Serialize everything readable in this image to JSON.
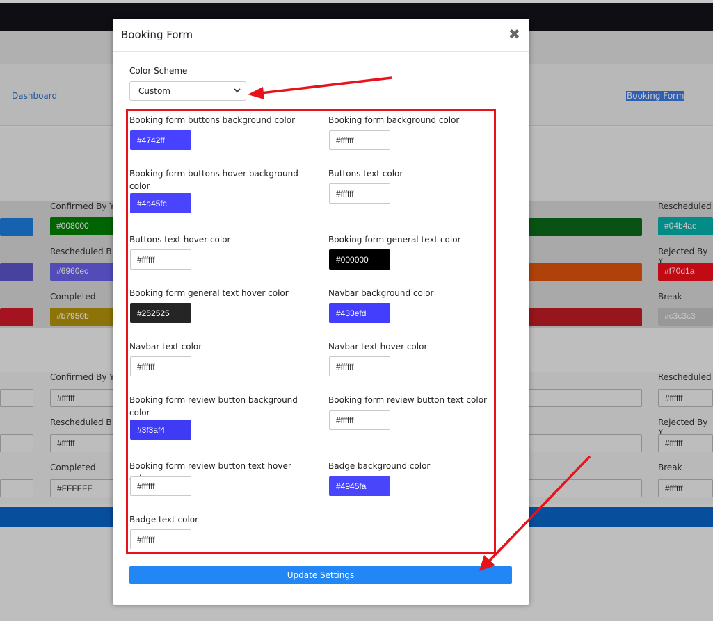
{
  "modal": {
    "title": "Booking Form",
    "color_scheme_label": "Color Scheme",
    "color_scheme_value": "Custom",
    "update_button_label": "Update Settings",
    "fields": [
      {
        "label": "Booking form buttons background color",
        "value": "#4742ff",
        "color": "#4742ff",
        "text_color": "#ffffff"
      },
      {
        "label": "Booking form background color",
        "value": "#ffffff",
        "color": "#ffffff",
        "text_color": "#222222"
      },
      {
        "label": "Booking form buttons hover background color",
        "value": "#4a45fc",
        "color": "#4a45fc",
        "text_color": "#ffffff"
      },
      {
        "label": "Buttons text color",
        "value": "#ffffff",
        "color": "#ffffff",
        "text_color": "#222222"
      },
      {
        "label": "Buttons text hover color",
        "value": "#ffffff",
        "color": "#ffffff",
        "text_color": "#222222"
      },
      {
        "label": "Booking form general text color",
        "value": "#000000",
        "color": "#000000",
        "text_color": "#ffffff"
      },
      {
        "label": "Booking form general text hover color",
        "value": "#252525",
        "color": "#252525",
        "text_color": "#ffffff"
      },
      {
        "label": "Navbar background color",
        "value": "#433efd",
        "color": "#433efd",
        "text_color": "#ffffff"
      },
      {
        "label": "Navbar text color",
        "value": "#ffffff",
        "color": "#ffffff",
        "text_color": "#222222"
      },
      {
        "label": "Navbar text hover color",
        "value": "#ffffff",
        "color": "#ffffff",
        "text_color": "#222222"
      },
      {
        "label": "Booking form review button background color",
        "value": "#3f3af4",
        "color": "#3f3af4",
        "text_color": "#ffffff"
      },
      {
        "label": "Booking form review button text color",
        "value": "#ffffff",
        "color": "#ffffff",
        "text_color": "#222222"
      },
      {
        "label": "Booking form review button text hover color",
        "value": "#ffffff",
        "color": "#ffffff",
        "text_color": "#222222"
      },
      {
        "label": "Badge background color",
        "value": "#4945fa",
        "color": "#4945fa",
        "text_color": "#ffffff"
      },
      {
        "label": "Badge text color",
        "value": "#ffffff",
        "color": "#ffffff",
        "text_color": "#222222"
      }
    ]
  },
  "background": {
    "nav_dashboard": "Dashboard",
    "nav_booking_form": "Booking Form",
    "labels": {
      "confirmed": "Confirmed By Y",
      "rescheduled_by": "Rescheduled B",
      "completed": "Completed",
      "rescheduled_right": "Rescheduled",
      "rejected": "Rejected By Y",
      "break": "Break"
    },
    "swatches": {
      "confirmed": "#008000",
      "rescheduled": "#6960ec",
      "completed": "#b7950b",
      "rescheduled_right": "#04b4ae",
      "rejected": "#f70d1a",
      "break": "#c3c3c3",
      "white_lower": "#ffffff",
      "white_upper": "#FFFFFF",
      "blue_left": "#1d7ee0",
      "purple_left": "#5b55c9",
      "red_left": "#d11a2a",
      "green_mid": "#0b6b1a",
      "orange_mid": "#e0550f",
      "red_mid": "#c21c24"
    }
  }
}
